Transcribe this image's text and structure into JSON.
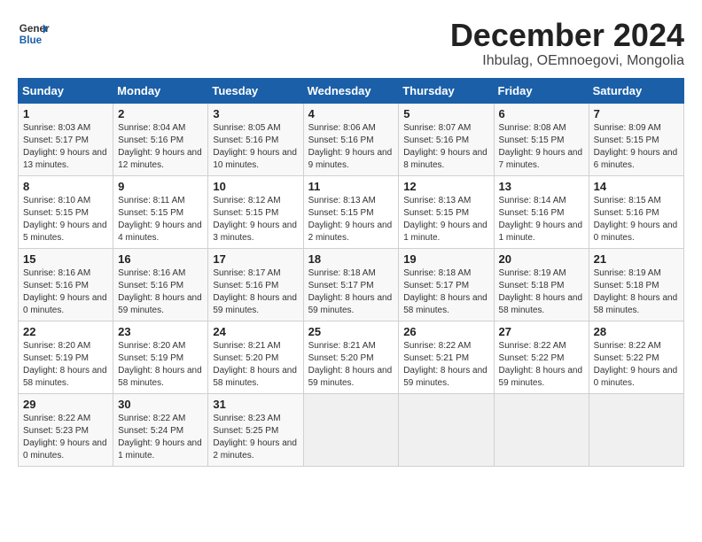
{
  "logo": {
    "text_general": "General",
    "text_blue": "Blue"
  },
  "title": "December 2024",
  "subtitle": "Ihbulag, OEmnoegovi, Mongolia",
  "header_days": [
    "Sunday",
    "Monday",
    "Tuesday",
    "Wednesday",
    "Thursday",
    "Friday",
    "Saturday"
  ],
  "weeks": [
    [
      {
        "num": "1",
        "sunrise": "Sunrise: 8:03 AM",
        "sunset": "Sunset: 5:17 PM",
        "daylight": "Daylight: 9 hours and 13 minutes."
      },
      {
        "num": "2",
        "sunrise": "Sunrise: 8:04 AM",
        "sunset": "Sunset: 5:16 PM",
        "daylight": "Daylight: 9 hours and 12 minutes."
      },
      {
        "num": "3",
        "sunrise": "Sunrise: 8:05 AM",
        "sunset": "Sunset: 5:16 PM",
        "daylight": "Daylight: 9 hours and 10 minutes."
      },
      {
        "num": "4",
        "sunrise": "Sunrise: 8:06 AM",
        "sunset": "Sunset: 5:16 PM",
        "daylight": "Daylight: 9 hours and 9 minutes."
      },
      {
        "num": "5",
        "sunrise": "Sunrise: 8:07 AM",
        "sunset": "Sunset: 5:16 PM",
        "daylight": "Daylight: 9 hours and 8 minutes."
      },
      {
        "num": "6",
        "sunrise": "Sunrise: 8:08 AM",
        "sunset": "Sunset: 5:15 PM",
        "daylight": "Daylight: 9 hours and 7 minutes."
      },
      {
        "num": "7",
        "sunrise": "Sunrise: 8:09 AM",
        "sunset": "Sunset: 5:15 PM",
        "daylight": "Daylight: 9 hours and 6 minutes."
      }
    ],
    [
      {
        "num": "8",
        "sunrise": "Sunrise: 8:10 AM",
        "sunset": "Sunset: 5:15 PM",
        "daylight": "Daylight: 9 hours and 5 minutes."
      },
      {
        "num": "9",
        "sunrise": "Sunrise: 8:11 AM",
        "sunset": "Sunset: 5:15 PM",
        "daylight": "Daylight: 9 hours and 4 minutes."
      },
      {
        "num": "10",
        "sunrise": "Sunrise: 8:12 AM",
        "sunset": "Sunset: 5:15 PM",
        "daylight": "Daylight: 9 hours and 3 minutes."
      },
      {
        "num": "11",
        "sunrise": "Sunrise: 8:13 AM",
        "sunset": "Sunset: 5:15 PM",
        "daylight": "Daylight: 9 hours and 2 minutes."
      },
      {
        "num": "12",
        "sunrise": "Sunrise: 8:13 AM",
        "sunset": "Sunset: 5:15 PM",
        "daylight": "Daylight: 9 hours and 1 minute."
      },
      {
        "num": "13",
        "sunrise": "Sunrise: 8:14 AM",
        "sunset": "Sunset: 5:16 PM",
        "daylight": "Daylight: 9 hours and 1 minute."
      },
      {
        "num": "14",
        "sunrise": "Sunrise: 8:15 AM",
        "sunset": "Sunset: 5:16 PM",
        "daylight": "Daylight: 9 hours and 0 minutes."
      }
    ],
    [
      {
        "num": "15",
        "sunrise": "Sunrise: 8:16 AM",
        "sunset": "Sunset: 5:16 PM",
        "daylight": "Daylight: 9 hours and 0 minutes."
      },
      {
        "num": "16",
        "sunrise": "Sunrise: 8:16 AM",
        "sunset": "Sunset: 5:16 PM",
        "daylight": "Daylight: 8 hours and 59 minutes."
      },
      {
        "num": "17",
        "sunrise": "Sunrise: 8:17 AM",
        "sunset": "Sunset: 5:16 PM",
        "daylight": "Daylight: 8 hours and 59 minutes."
      },
      {
        "num": "18",
        "sunrise": "Sunrise: 8:18 AM",
        "sunset": "Sunset: 5:17 PM",
        "daylight": "Daylight: 8 hours and 59 minutes."
      },
      {
        "num": "19",
        "sunrise": "Sunrise: 8:18 AM",
        "sunset": "Sunset: 5:17 PM",
        "daylight": "Daylight: 8 hours and 58 minutes."
      },
      {
        "num": "20",
        "sunrise": "Sunrise: 8:19 AM",
        "sunset": "Sunset: 5:18 PM",
        "daylight": "Daylight: 8 hours and 58 minutes."
      },
      {
        "num": "21",
        "sunrise": "Sunrise: 8:19 AM",
        "sunset": "Sunset: 5:18 PM",
        "daylight": "Daylight: 8 hours and 58 minutes."
      }
    ],
    [
      {
        "num": "22",
        "sunrise": "Sunrise: 8:20 AM",
        "sunset": "Sunset: 5:19 PM",
        "daylight": "Daylight: 8 hours and 58 minutes."
      },
      {
        "num": "23",
        "sunrise": "Sunrise: 8:20 AM",
        "sunset": "Sunset: 5:19 PM",
        "daylight": "Daylight: 8 hours and 58 minutes."
      },
      {
        "num": "24",
        "sunrise": "Sunrise: 8:21 AM",
        "sunset": "Sunset: 5:20 PM",
        "daylight": "Daylight: 8 hours and 58 minutes."
      },
      {
        "num": "25",
        "sunrise": "Sunrise: 8:21 AM",
        "sunset": "Sunset: 5:20 PM",
        "daylight": "Daylight: 8 hours and 59 minutes."
      },
      {
        "num": "26",
        "sunrise": "Sunrise: 8:22 AM",
        "sunset": "Sunset: 5:21 PM",
        "daylight": "Daylight: 8 hours and 59 minutes."
      },
      {
        "num": "27",
        "sunrise": "Sunrise: 8:22 AM",
        "sunset": "Sunset: 5:22 PM",
        "daylight": "Daylight: 8 hours and 59 minutes."
      },
      {
        "num": "28",
        "sunrise": "Sunrise: 8:22 AM",
        "sunset": "Sunset: 5:22 PM",
        "daylight": "Daylight: 9 hours and 0 minutes."
      }
    ],
    [
      {
        "num": "29",
        "sunrise": "Sunrise: 8:22 AM",
        "sunset": "Sunset: 5:23 PM",
        "daylight": "Daylight: 9 hours and 0 minutes."
      },
      {
        "num": "30",
        "sunrise": "Sunrise: 8:22 AM",
        "sunset": "Sunset: 5:24 PM",
        "daylight": "Daylight: 9 hours and 1 minute."
      },
      {
        "num": "31",
        "sunrise": "Sunrise: 8:23 AM",
        "sunset": "Sunset: 5:25 PM",
        "daylight": "Daylight: 9 hours and 2 minutes."
      },
      null,
      null,
      null,
      null
    ]
  ]
}
